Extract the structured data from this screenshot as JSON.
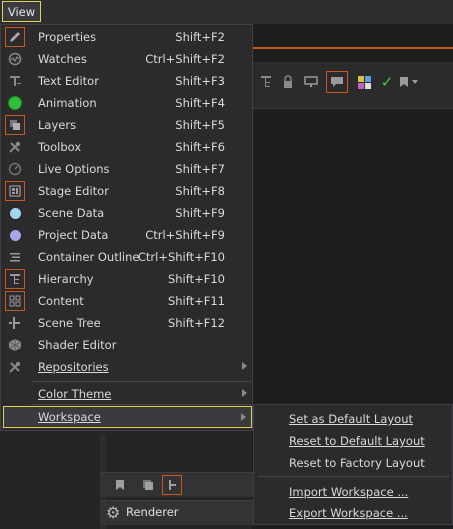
{
  "menubar": {
    "view_label": "View"
  },
  "menu": {
    "items": [
      {
        "label": "Properties",
        "shortcut": "Shift+F2",
        "icon": "pencil-icon"
      },
      {
        "label": "Watches",
        "shortcut": "Ctrl+Shift+F2",
        "icon": "watch-icon"
      },
      {
        "label": "Text Editor",
        "shortcut": "Shift+F3",
        "icon": "text-editor-icon"
      },
      {
        "label": "Animation",
        "shortcut": "Shift+F4",
        "icon": "animation-icon"
      },
      {
        "label": "Layers",
        "shortcut": "Shift+F5",
        "icon": "layers-icon"
      },
      {
        "label": "Toolbox",
        "shortcut": "Shift+F6",
        "icon": "toolbox-icon"
      },
      {
        "label": "Live Options",
        "shortcut": "Shift+F7",
        "icon": "live-options-icon"
      },
      {
        "label": "Stage Editor",
        "shortcut": "Shift+F8",
        "icon": "stage-editor-icon"
      },
      {
        "label": "Scene Data",
        "shortcut": "Shift+F9",
        "icon": "scene-data-icon"
      },
      {
        "label": "Project Data",
        "shortcut": "Ctrl+Shift+F9",
        "icon": "project-data-icon"
      },
      {
        "label": "Container Outline",
        "shortcut": "Ctrl+Shift+F10",
        "icon": "container-outline-icon"
      },
      {
        "label": "Hierarchy",
        "shortcut": "Shift+F10",
        "icon": "hierarchy-icon"
      },
      {
        "label": "Content",
        "shortcut": "Shift+F11",
        "icon": "content-icon"
      },
      {
        "label": "Scene Tree",
        "shortcut": "Shift+F12",
        "icon": "scene-tree-icon"
      },
      {
        "label": "Shader Editor",
        "shortcut": "",
        "icon": "shader-editor-icon"
      },
      {
        "label": "Repositories",
        "shortcut": "",
        "icon": "repositories-icon"
      }
    ],
    "color_theme_label": "Color Theme",
    "workspace_label": "Workspace"
  },
  "workspace_submenu": {
    "items": [
      "Set as Default Layout",
      "Reset to Default Layout",
      "Reset to Factory Layout",
      "Import Workspace ...",
      "Export Workspace ..."
    ]
  },
  "renderer": {
    "label": "Renderer"
  },
  "colors": {
    "accent_orange": "#c8581e",
    "highlight_yellow": "#e0d44a",
    "animation_green": "#2fbf3a",
    "checkmark_green": "#3fcf3f"
  }
}
